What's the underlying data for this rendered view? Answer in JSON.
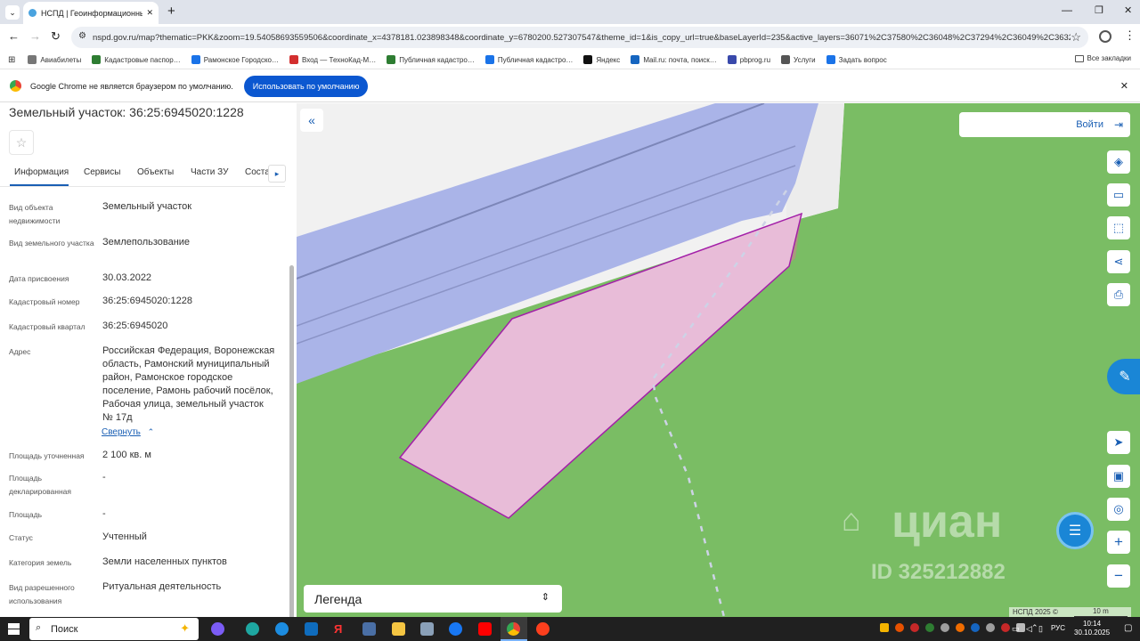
{
  "browser": {
    "tab_title": "НСПД | Геоинформационный по",
    "new_tab": "+",
    "url": "nspd.gov.ru/map?thematic=PKK&zoom=19.54058693559506&coordinate_x=4378181.023898348&coordinate_y=6780200.527307547&theme_id=1&is_copy_url=true&baseLayerId=235&active_layers=36071%2C37580%2C36048%2C37294%2C36049%2C3632…",
    "bookmarks": [
      {
        "label": "Авиабилеты",
        "color": "#777"
      },
      {
        "label": "Кадастровые паспор…",
        "color": "#2e7d32"
      },
      {
        "label": "Рамонское Городско…",
        "color": "#1a73e8"
      },
      {
        "label": "Вход — ТехноКад-М…",
        "color": "#d32f2f"
      },
      {
        "label": "Публичная кадастро…",
        "color": "#2e7d32"
      },
      {
        "label": "Публичная кадастро…",
        "color": "#1a73e8"
      },
      {
        "label": "Яндекс",
        "color": "#111"
      },
      {
        "label": "Mail.ru: почта, поиск…",
        "color": "#1565c0"
      },
      {
        "label": "pbprog.ru",
        "color": "#3949ab"
      },
      {
        "label": "Услуги",
        "color": "#555"
      },
      {
        "label": "Задать вопрос",
        "color": "#1a73e8"
      }
    ],
    "all_bookmarks": "Все закладки",
    "infobar_text": "Google Chrome не является браузером по умолчанию.",
    "infobar_button": "Использовать по умолчанию"
  },
  "panel": {
    "title": "Земельный участок: 36:25:6945020:1228",
    "tabs": [
      "Информация",
      "Сервисы",
      "Объекты",
      "Части ЗУ",
      "Соста"
    ],
    "fields": [
      {
        "label": "Вид объекта недвижимости",
        "value": "Земельный участок"
      },
      {
        "label": "Вид земельного участка",
        "value": "Землепользование"
      },
      {
        "label": "Дата присвоения",
        "value": "30.03.2022"
      },
      {
        "label": "Кадастровый номер",
        "value": "36:25:6945020:1228"
      },
      {
        "label": "Кадастровый квартал",
        "value": "36:25:6945020"
      },
      {
        "label": "Адрес",
        "value": "Российская Федерация, Воронежская область, Рамонский муниципальный район, Рамонское городское поселение, Рамонь рабочий посёлок, Рабочая улица, земельный участок № 17д"
      },
      {
        "label": "Площадь уточненная",
        "value": "2 100 кв. м"
      },
      {
        "label": "Площадь декларированная",
        "value": "-"
      },
      {
        "label": "Площадь",
        "value": "-"
      },
      {
        "label": "Статус",
        "value": "Учтенный"
      },
      {
        "label": "Категория земель",
        "value": "Земли населенных пунктов"
      },
      {
        "label": "Вид разрешенного использования",
        "value": "Ритуальная деятельность"
      }
    ],
    "collapse_link": "Свернуть"
  },
  "map": {
    "login": "Войти",
    "legend": "Легенда",
    "watermark_text": "циан",
    "watermark_id": "ID 325212882",
    "copyright": "НСПД 2025 ©",
    "scale": "10 m",
    "colors": {
      "ground": "#7abd64",
      "road_band": "#aab4e8",
      "parcel": "#e8bcd8",
      "parcel_border": "#a31fa8"
    }
  },
  "taskbar": {
    "search": "Поиск",
    "lang": "РУС",
    "time": "10:14",
    "date": "30.10.2025"
  }
}
